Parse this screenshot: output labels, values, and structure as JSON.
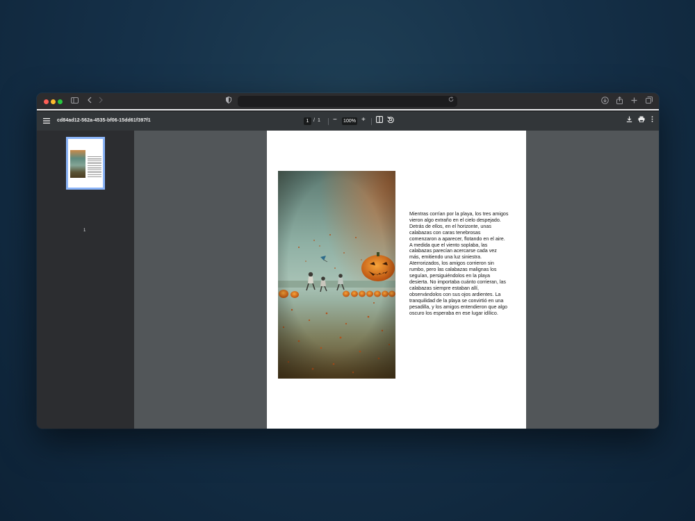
{
  "browser": {
    "address": "",
    "icons": [
      "sidebar-icon",
      "back-icon",
      "forward-icon",
      "privacy-shield-icon",
      "reload-icon",
      "download-icon",
      "share-icon",
      "new-tab-icon",
      "tabs-overview-icon"
    ]
  },
  "pdf_toolbar": {
    "title": "cd84ad12-562a-4535-bf06-15dd61f397f1",
    "current_page": "1",
    "page_separator": "/",
    "total_pages": "1",
    "zoom": "100%",
    "zoom_out": "−",
    "zoom_in": "+"
  },
  "sidebar": {
    "thumbnails": [
      {
        "number": "1"
      }
    ]
  },
  "document": {
    "story": "Mientras corrían por la playa, los tres amigos\nvieron algo extraño en el cielo despejado.\nDetrás de ellos, en el horizonte, unas\ncalabazas con caras tenebrosas\ncomenzaron a aparecer, flotando en el aire.\nA medida que el viento soplaba, las\ncalabazas parecían acercarse cada vez\nmás, emitiendo una luz siniestra.\nAterrorizados, los amigos corrieron sin\nrumbo, pero las calabazas malignas los\nseguían, persiguiéndolos en la playa\ndesierta. No importaba cuánto corrieran, las\ncalabazas siempre estaban allí,\nobservándolos con sus ojos ardientes. La\ntranquilidad de la playa se convirtió en una\npesadilla, y los amigos entendieron que algo\noscuro los esperaba en ese lugar idílico."
  },
  "colors": {
    "desktop": "#153048",
    "toolbar": "#323639",
    "sidebar": "#2c2d30",
    "viewer_bg": "#525659",
    "thumbnail_border": "#8ab4f8"
  }
}
